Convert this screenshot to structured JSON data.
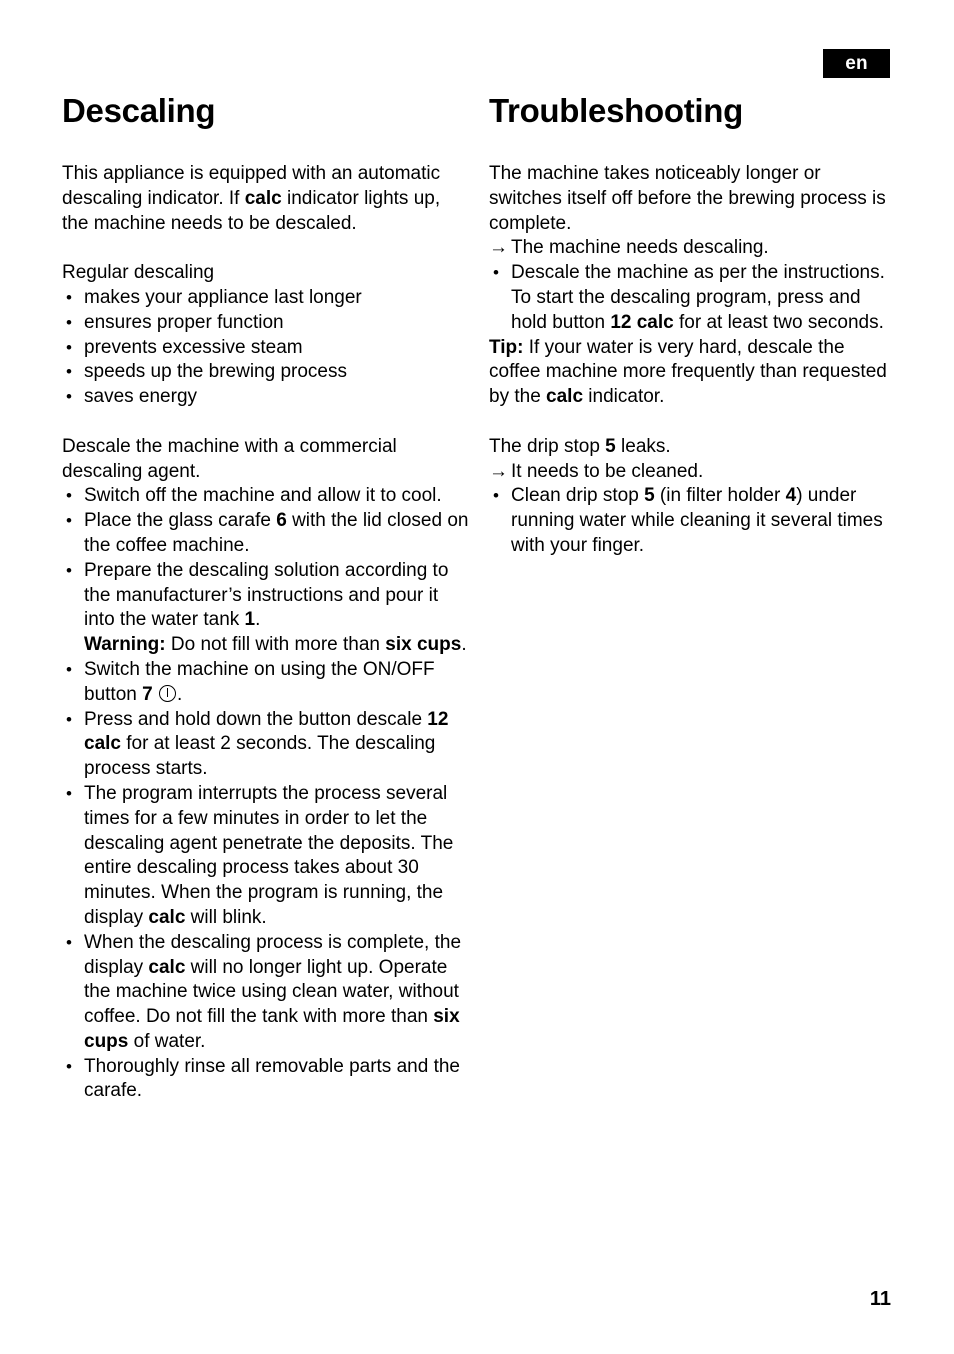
{
  "document": {
    "language_badge": "en",
    "page_number": "11"
  },
  "left_column": {
    "title": "Descaling",
    "intro": {
      "part1": "This appliance is equipped with an automatic descaling indicator. If ",
      "bold1": "calc",
      "part2": " indicator lights up, the machine needs to be descaled."
    },
    "benefits_heading": "Regular descaling",
    "benefits": [
      "makes your appliance last longer",
      "ensures proper function",
      "prevents excessive steam",
      "speeds up the brewing process",
      "saves energy"
    ],
    "agent_paragraph": "Descale the machine with a commercial descaling agent.",
    "steps": {
      "step1": "Switch off the machine and allow it to cool.",
      "step2_part1": "Place the glass carafe ",
      "step2_bold": "6",
      "step2_part2": " with the lid closed on the coffee machine.",
      "step3_part1": "Prepare the descaling solution according to the manufacturer’s instructions and pour it into the water tank ",
      "step3_bold1": "1",
      "step3_part2": ".",
      "step3_warning_label": "Warning:",
      "step3_part3": " Do not fill with more than ",
      "step3_bold2": "six cups",
      "step3_part4": ".",
      "step4_part1": "Switch the machine on using the ON/OFF button ",
      "step4_bold": "7",
      "step4_icon": "power-symbol",
      "step4_part2": ".",
      "step5_part1": "Press and hold down the button descale ",
      "step5_bold": "12 calc",
      "step5_part2": " for at least 2 seconds. The descaling process starts.",
      "step6_part1": "The program interrupts the process several times for a few minutes in order to let the descaling agent penetrate the deposits. The entire descaling process takes about 30 minutes. When the program is running, the display ",
      "step6_bold": "calc",
      "step6_part2": " will blink.",
      "step7_part1": "When the descaling process is complete, the display ",
      "step7_bold1": "calc",
      "step7_part2": " will no longer light up. Operate the machine twice using clean water, without coffee. Do not fill the tank with more than ",
      "step7_bold2": "six cups",
      "step7_part3": " of water.",
      "step8": "Thoroughly rinse all removable parts and the carafe."
    }
  },
  "right_column": {
    "title": "Troubleshooting",
    "problem1": {
      "statement": "The machine takes noticeably longer or switches itself off before the brewing process is complete.",
      "arrow_glyph": "→",
      "cause": "The machine needs descaling.",
      "remedy_part1": "Descale the machine as per the instructions. To start the descaling program, press and hold button ",
      "remedy_bold": "12 calc",
      "remedy_part2": " for at least two seconds.",
      "tip_label": "Tip:",
      "tip_part1": " If your water is very hard, descale the coffee machine more frequently than requested by the ",
      "tip_bold": "calc",
      "tip_part2": " indicator."
    },
    "problem2": {
      "statement_part1": "The drip stop ",
      "statement_bold": "5",
      "statement_part2": " leaks.",
      "arrow_glyph": "→",
      "cause": "It needs to be cleaned.",
      "remedy_part1": "Clean drip stop ",
      "remedy_bold1": "5",
      "remedy_part2": " (in filter holder ",
      "remedy_bold2": "4",
      "remedy_part3": ") under running water while cleaning it several times with your finger."
    }
  }
}
